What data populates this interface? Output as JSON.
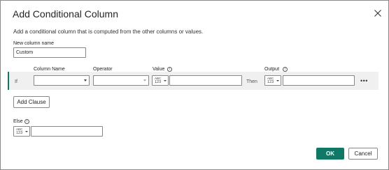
{
  "dialog": {
    "title": "Add Conditional Column",
    "description": "Add a conditional column that is computed from the other columns or values."
  },
  "new_column": {
    "label": "New column name",
    "value": "Custom"
  },
  "headers": {
    "column_name": "Column Name",
    "operator": "Operator",
    "value": "Value",
    "output": "Output"
  },
  "clause": {
    "if_label": "If",
    "then_label": "Then",
    "column_name_value": "",
    "operator_value": "",
    "value_value": "",
    "output_value": "",
    "more_label": "•••"
  },
  "type_selector": {
    "abc": "ABC",
    "num": "123"
  },
  "add_clause": {
    "label": "Add Clause"
  },
  "else": {
    "label": "Else",
    "value": ""
  },
  "info_glyph": "i",
  "buttons": {
    "ok": "OK",
    "cancel": "Cancel"
  },
  "colors": {
    "primary": "#117865",
    "band": "#f0f0f0",
    "border": "#8a8886"
  },
  "icons": {
    "close": "close-icon",
    "info": "info-icon",
    "dropdown": "chevron-down-icon"
  }
}
